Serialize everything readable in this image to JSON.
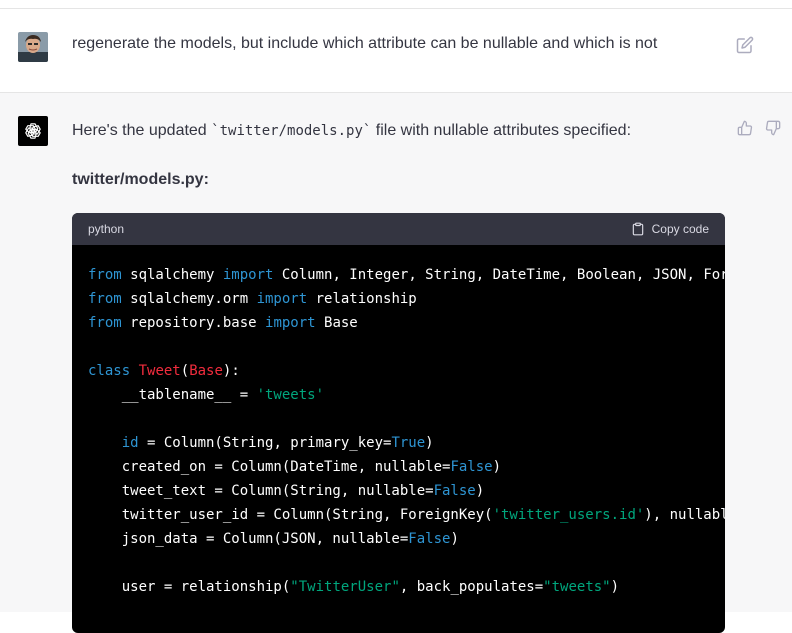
{
  "user_message": {
    "text": "regenerate the models, but include which attribute can be nullable and which is not",
    "edit_icon": "pencil-square-icon"
  },
  "assistant_message": {
    "intro_before": "Here's the updated ",
    "intro_code": "`twitter/models.py`",
    "intro_after": " file with nullable attributes specified:",
    "filename": "twitter/models.py:",
    "feedback_icons": [
      "thumbs-up-icon",
      "thumbs-down-icon"
    ]
  },
  "code_block": {
    "language": "python",
    "copy_label": "Copy code",
    "lines": [
      [
        [
          "kw",
          "from"
        ],
        [
          "t",
          " sqlalchemy "
        ],
        [
          "kw",
          "import"
        ],
        [
          "t",
          " Column, Integer, String, DateTime, Boolean, JSON, ForeignKey"
        ]
      ],
      [
        [
          "kw",
          "from"
        ],
        [
          "t",
          " sqlalchemy.orm "
        ],
        [
          "kw",
          "import"
        ],
        [
          "t",
          " relationship"
        ]
      ],
      [
        [
          "kw",
          "from"
        ],
        [
          "t",
          " repository.base "
        ],
        [
          "kw",
          "import"
        ],
        [
          "t",
          " Base"
        ]
      ],
      [],
      [
        [
          "kw",
          "class"
        ],
        [
          "t",
          " "
        ],
        [
          "cls",
          "Tweet"
        ],
        [
          "t",
          "("
        ],
        [
          "cls",
          "Base"
        ],
        [
          "t",
          "):"
        ]
      ],
      [
        [
          "t",
          "    __tablename__ = "
        ],
        [
          "str",
          "'tweets'"
        ]
      ],
      [],
      [
        [
          "t",
          "    "
        ],
        [
          "kw",
          "id"
        ],
        [
          "t",
          " = Column(String, primary_key="
        ],
        [
          "lit",
          "True"
        ],
        [
          "t",
          ")"
        ]
      ],
      [
        [
          "t",
          "    created_on = Column(DateTime, nullable="
        ],
        [
          "lit",
          "False"
        ],
        [
          "t",
          ")"
        ]
      ],
      [
        [
          "t",
          "    tweet_text = Column(String, nullable="
        ],
        [
          "lit",
          "False"
        ],
        [
          "t",
          ")"
        ]
      ],
      [
        [
          "t",
          "    twitter_user_id = Column(String, ForeignKey("
        ],
        [
          "str",
          "'twitter_users.id'"
        ],
        [
          "t",
          "), nullable=False)"
        ]
      ],
      [
        [
          "t",
          "    json_data = Column(JSON, nullable="
        ],
        [
          "lit",
          "False"
        ],
        [
          "t",
          ")"
        ]
      ],
      [],
      [
        [
          "t",
          "    user = relationship("
        ],
        [
          "str",
          "\"TwitterUser\""
        ],
        [
          "t",
          ", back_populates="
        ],
        [
          "str",
          "\"tweets\""
        ],
        [
          "t",
          ")"
        ]
      ]
    ]
  },
  "colors": {
    "page_bg": "#ffffff",
    "assistant_bg": "#f7f7f8",
    "code_bg": "#000000",
    "code_header_bg": "#343541",
    "keyword": "#2e95d3",
    "class_name": "#f22c3d",
    "string": "#00a67d"
  }
}
